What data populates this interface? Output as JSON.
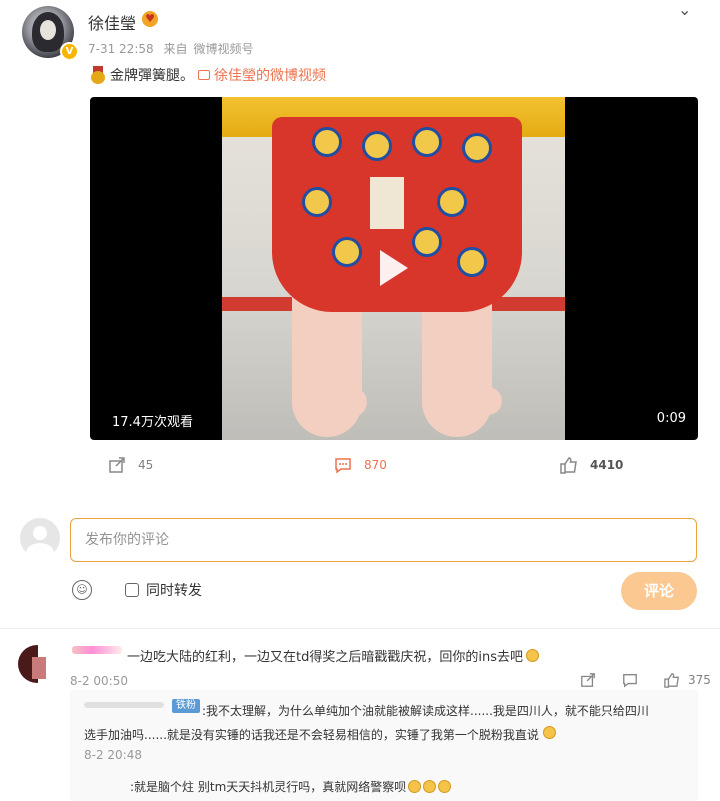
{
  "post": {
    "username": "徐佳瑩",
    "timestamp": "7-31 22:58",
    "source_label": "来自",
    "source": "微博视频号",
    "text": "金牌彈簧腿。",
    "video_link": "徐佳瑩的微博视频",
    "video": {
      "views": "17.4万次观看",
      "duration": "0:09"
    },
    "actions": {
      "repost_count": "45",
      "comment_count": "870",
      "like_count": "4410"
    }
  },
  "composer": {
    "placeholder": "发布你的评论",
    "repost_label": "同时转发",
    "submit_label": "评论"
  },
  "comments": [
    {
      "text": "一边吃大陆的红利，一边又在td得奖之后暗戳戳庆祝，回你的ins去吧",
      "time": "8-2 00:50",
      "like_count": "375",
      "replies": [
        {
          "tag": "铁粉",
          "text_line1": ":我不太理解，为什么单纯加个油就能被解读成这样......我是四川人，就不能只给四川",
          "text_line2": "选手加油吗......就是没有实锤的话我还是不会轻易相信的，实锤了我第一个脱粉我直说",
          "time": "8-2 20:48"
        },
        {
          "text": ":就是脑个炷 别tm天天抖机灵行吗，真就网络警察呗"
        }
      ]
    }
  ],
  "colors": {
    "accent": "#eb7350",
    "submit_bg": "#fbc891",
    "input_border": "#f0a03c",
    "verified_badge": "#f7b500"
  }
}
